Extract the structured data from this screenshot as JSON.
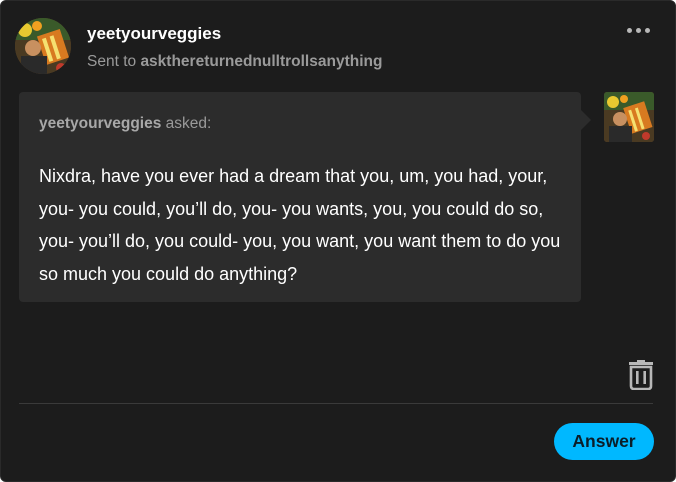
{
  "post": {
    "author": "yeetyourveggies",
    "sent_to_label": "Sent to",
    "recipient": "askthereturnednulltrollsanything",
    "more_icon": "more-horizontal-icon"
  },
  "ask": {
    "asker": "yeetyourveggies",
    "asked_label": "asked:",
    "question": "Nixdra, have you ever had a dream that you, um, you had, your, you- you could, you’ll do, you- you wants, you, you could do so, you- you’ll do, you could- you, you want, you want them to do you so much you could do anything?"
  },
  "actions": {
    "delete_icon": "trash-icon",
    "answer_label": "Answer"
  },
  "colors": {
    "background": "#1c1c1c",
    "bubble": "#2c2c2c",
    "accent": "#00b8ff"
  }
}
